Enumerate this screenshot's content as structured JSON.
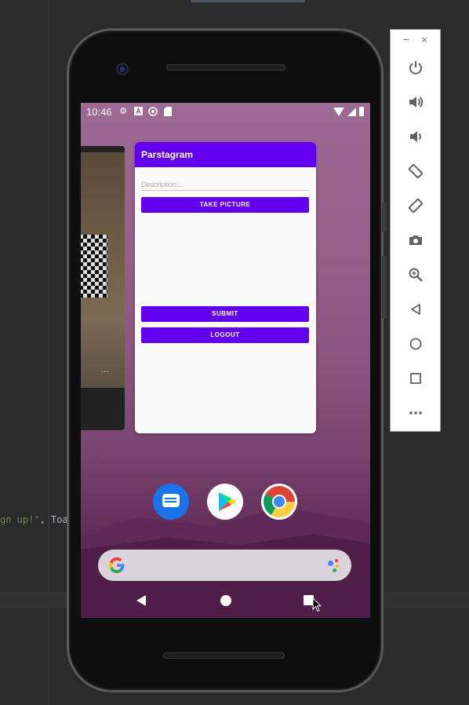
{
  "ide": {
    "code_string": "gn up!\"",
    "code_rest": ", Toas"
  },
  "status_bar": {
    "time": "10:46",
    "icons_left": [
      "gear-icon",
      "font-icon",
      "cast-icon",
      "sd-card-icon"
    ],
    "icons_right": [
      "wifi-icon",
      "signal-icon",
      "battery-icon"
    ]
  },
  "app": {
    "title": "Parstagram",
    "description_placeholder": "Description...",
    "take_picture_label": "TAKE PICTURE",
    "submit_label": "SUBMIT",
    "logout_label": "LOGOUT",
    "accent_color": "#6200ee"
  },
  "recent_card": {
    "menu": "..."
  },
  "dock": [
    "messages-icon",
    "play-store-icon",
    "chrome-icon"
  ],
  "emulator_panel": {
    "minimize": "−",
    "close": "×",
    "tools": [
      "power-icon",
      "volume-up-icon",
      "volume-down-icon",
      "rotate-left-icon",
      "rotate-right-icon",
      "camera-icon",
      "zoom-icon",
      "back-icon",
      "home-icon",
      "overview-icon",
      "more-icon"
    ]
  }
}
